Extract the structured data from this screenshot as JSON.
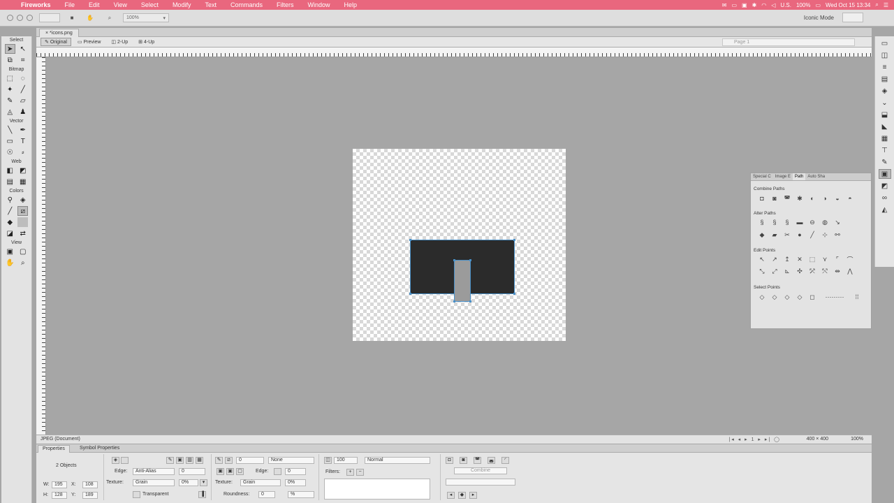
{
  "menubar": {
    "app_name": "Fireworks",
    "items": [
      "File",
      "Edit",
      "View",
      "Select",
      "Modify",
      "Text",
      "Commands",
      "Filters",
      "Window",
      "Help"
    ],
    "status": {
      "input_source": "U.S.",
      "battery": "100%",
      "clock": "Wed Oct 15  13:34"
    }
  },
  "toolbar": {
    "zoom_value": "100%",
    "workspace": "Iconic Mode"
  },
  "document": {
    "tab_label": "*icons.png",
    "views": [
      "Original",
      "Preview",
      "2-Up",
      "4-Up"
    ],
    "page_select": "Page 1"
  },
  "tools": {
    "sections": [
      "Select",
      "Bitmap",
      "Vector",
      "Web",
      "Colors",
      "View"
    ]
  },
  "statusbar": {
    "doc_type": "JPEG (Document)",
    "nav_page": "1",
    "dimensions": "400 × 400",
    "zoom": "100%"
  },
  "properties": {
    "tabs": [
      "Properties",
      "Symbol Properties"
    ],
    "selection_label": "2 Objects",
    "w": "195",
    "h": "128",
    "x": "108",
    "y": "189",
    "edge_label": "Edge:",
    "edge_mode": "Anti-Alias",
    "edge_value": "0",
    "texture_label": "Texture:",
    "texture": "Grain",
    "texture_value": "0%",
    "transparent_label": "Transparent",
    "stroke_size": "0",
    "stroke_type": "None",
    "stroke_edge_label": "Edge:",
    "stroke_edge_value": "0",
    "stroke_texture_label": "Texture:",
    "stroke_texture": "Grain",
    "stroke_texture_value": "0%",
    "roundness_label": "Roundness:",
    "roundness_value": "0",
    "opacity_value": "100",
    "blend_mode": "Normal",
    "filters_label": "Filters:",
    "combine_label": "Combine"
  },
  "path_panel": {
    "tabs": [
      "Special C",
      "Image E",
      "Path",
      "Auto Sha"
    ],
    "sections": [
      "Combine Paths",
      "Alter Paths",
      "Edit Points",
      "Select Points"
    ]
  }
}
